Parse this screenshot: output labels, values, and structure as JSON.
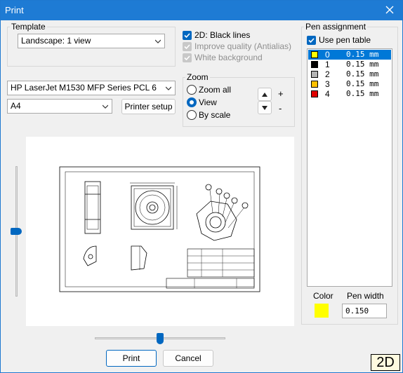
{
  "window": {
    "title": "Print"
  },
  "template": {
    "group_label": "Template",
    "selected": "Landscape: 1 view"
  },
  "options": {
    "black_lines": {
      "label": "2D: Black lines",
      "checked": true
    },
    "antialias": {
      "label": "Improve quality (Antialias)",
      "checked": true,
      "enabled": false
    },
    "white_background": {
      "label": "White background",
      "checked": true,
      "enabled": false
    }
  },
  "printer": {
    "selected": "HP LaserJet M1530 MFP Series PCL 6",
    "paper": "A4",
    "setup_label": "Printer setup"
  },
  "zoom": {
    "group_label": "Zoom",
    "options": [
      {
        "label": "Zoom all",
        "selected": false
      },
      {
        "label": "View",
        "selected": true
      },
      {
        "label": "By scale",
        "selected": false
      }
    ],
    "plus_label": "+",
    "minus_label": "-"
  },
  "pens": {
    "group_label": "Pen assignment",
    "use_table": {
      "label": "Use pen table",
      "checked": true
    },
    "rows": [
      {
        "num": "0",
        "width": "0.15 mm",
        "color": "#ffff00",
        "selected": true
      },
      {
        "num": "1",
        "width": "0.15 mm",
        "color": "#000000",
        "selected": false
      },
      {
        "num": "2",
        "width": "0.15 mm",
        "color": "#b4b4b4",
        "selected": false
      },
      {
        "num": "3",
        "width": "0.15 mm",
        "color": "#ffc000",
        "selected": false
      },
      {
        "num": "4",
        "width": "0.15 mm",
        "color": "#e00000",
        "selected": false
      }
    ],
    "color_label": "Color",
    "pen_width_label": "Pen width",
    "selected_color": "#ffff00",
    "pen_width_value": "0.150"
  },
  "buttons": {
    "print": "Print",
    "cancel": "Cancel"
  },
  "mode_badge": "2D"
}
